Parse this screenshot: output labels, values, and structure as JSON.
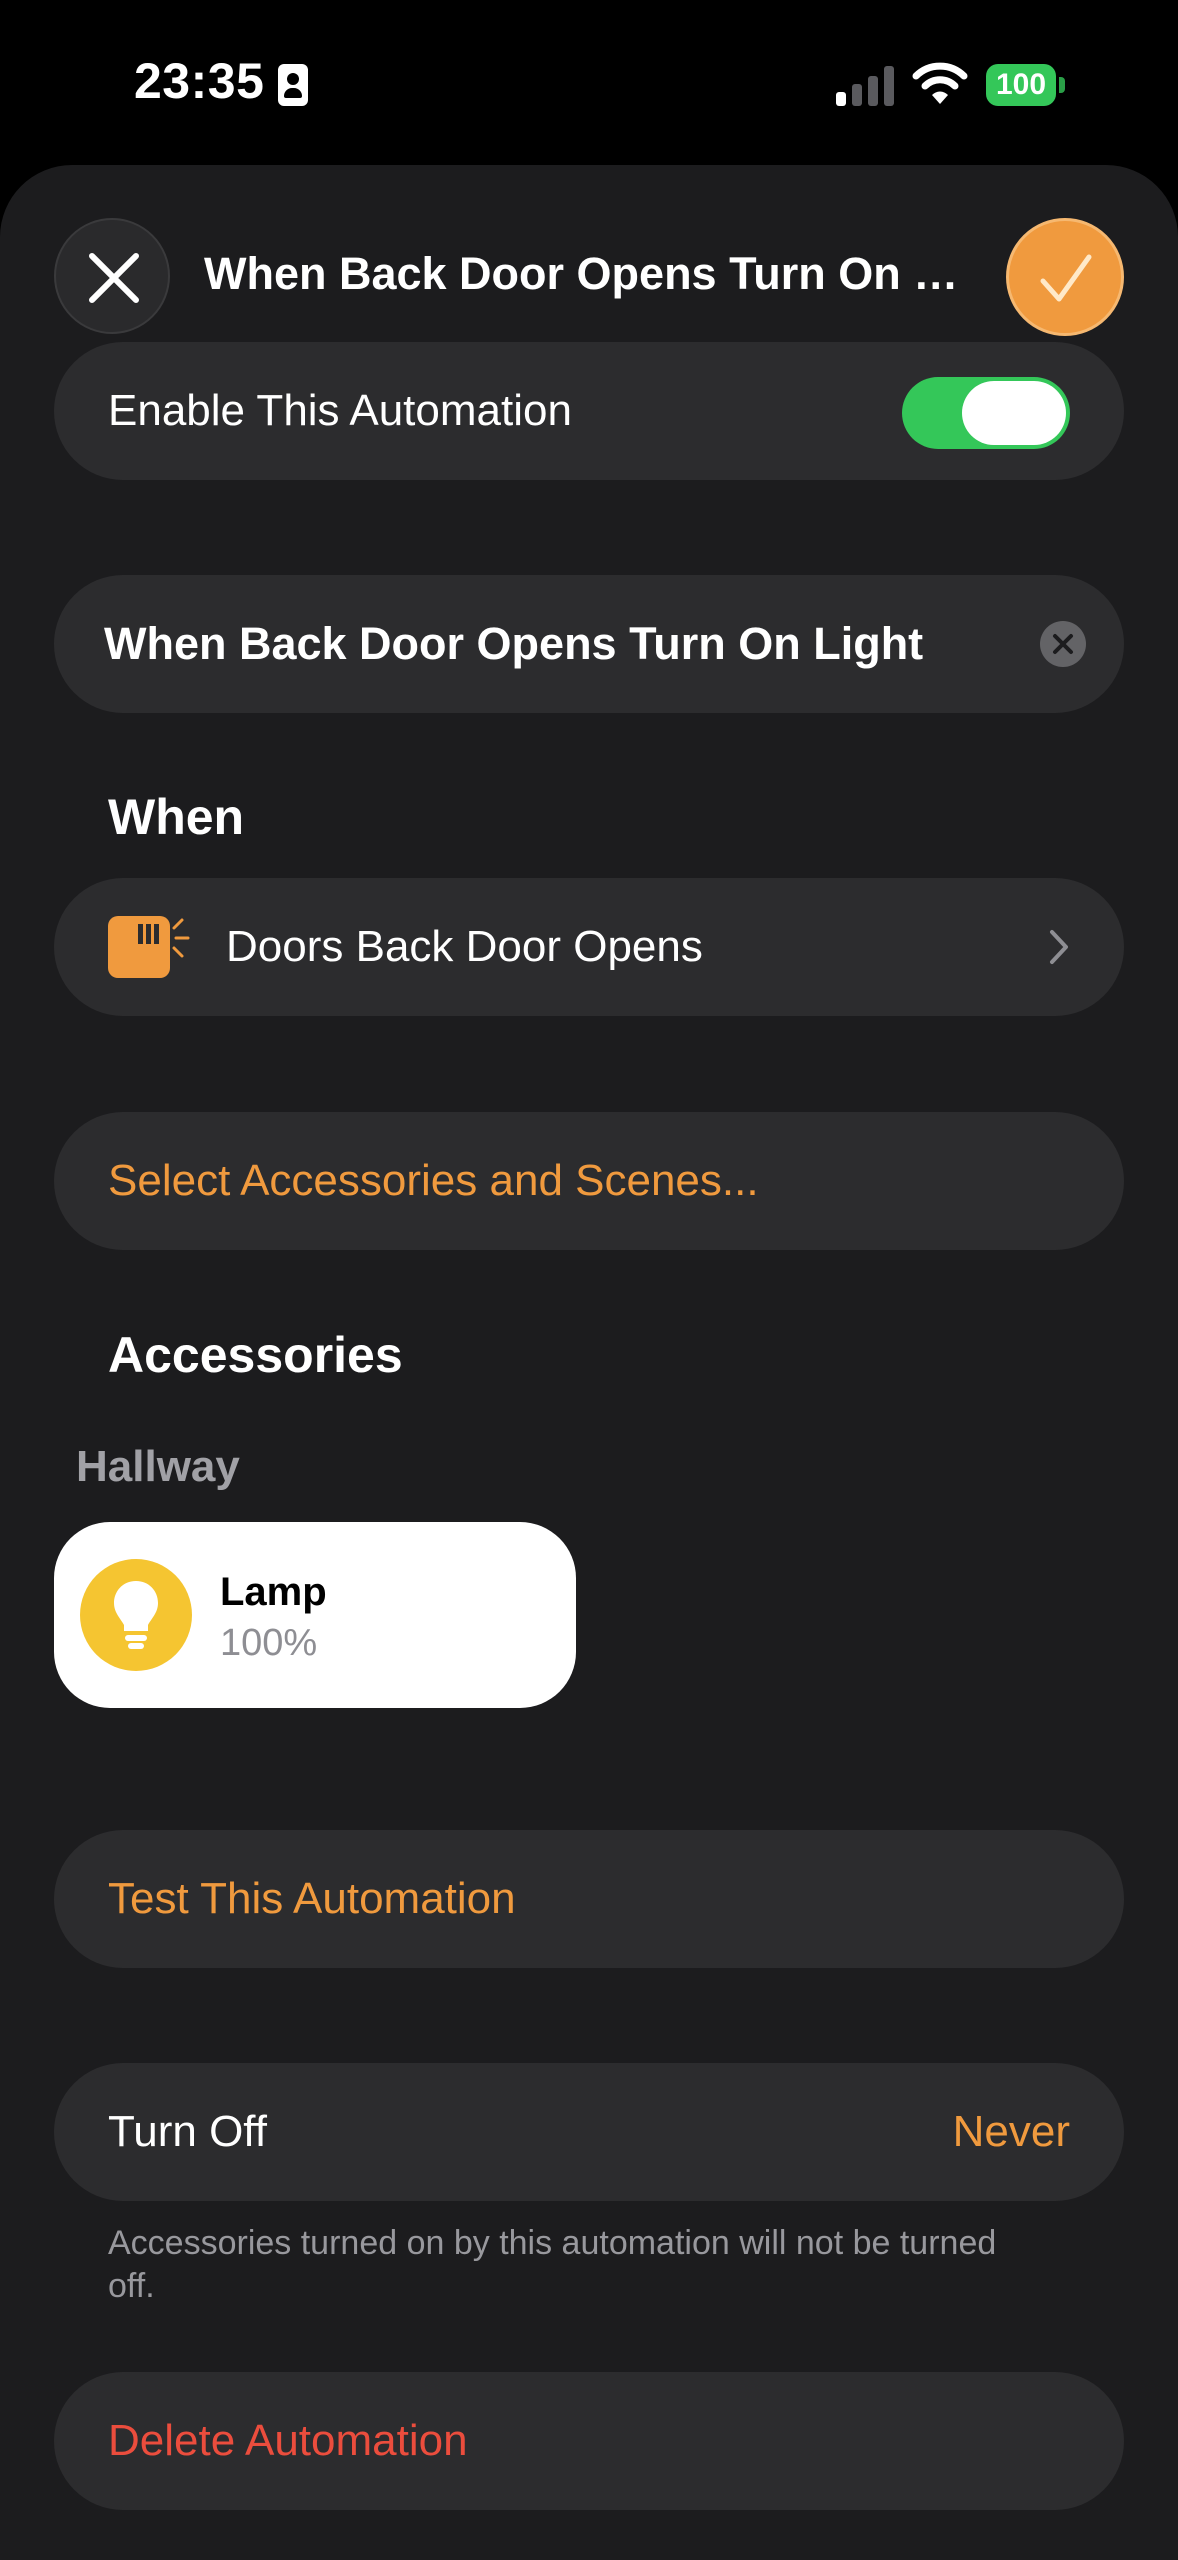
{
  "status_bar": {
    "time": "23:35",
    "battery": "100"
  },
  "header": {
    "title": "When Back Door Opens Turn On Li..."
  },
  "enable": {
    "label": "Enable This Automation",
    "enabled": true
  },
  "name_field": {
    "value": "When Back Door Opens Turn On Light"
  },
  "when": {
    "heading": "When",
    "trigger": "Doors Back Door Opens"
  },
  "select_action": {
    "label": "Select Accessories and Scenes..."
  },
  "accessories": {
    "heading": "Accessories",
    "room": "Hallway",
    "items": [
      {
        "name": "Lamp",
        "level": "100%"
      }
    ]
  },
  "test": {
    "label": "Test This Automation"
  },
  "turn_off": {
    "label": "Turn Off",
    "value": "Never",
    "note": "Accessories turned on by this automation will not be turned off."
  },
  "delete": {
    "label": "Delete Automation"
  },
  "colors": {
    "accent": "#f09a3e",
    "toggle_on": "#34c759",
    "destructive": "#eb4d3d",
    "sheet_bg": "#1c1c1e",
    "row_bg": "#2c2c2e"
  }
}
